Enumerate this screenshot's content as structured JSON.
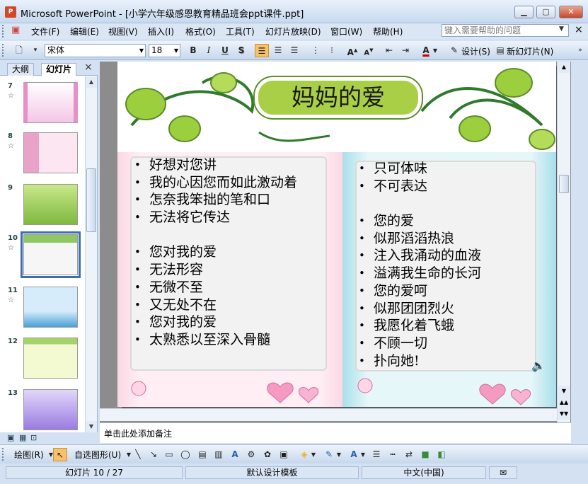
{
  "window": {
    "title": "Microsoft PowerPoint - [小学六年级感恩教育精品班会ppt课件.ppt]",
    "app_icon": "powerpoint-icon",
    "controls": [
      "minimize",
      "maximize",
      "close"
    ]
  },
  "menu": {
    "items": [
      "文件(F)",
      "编辑(E)",
      "视图(V)",
      "插入(I)",
      "格式(O)",
      "工具(T)",
      "幻灯片放映(D)",
      "窗口(W)",
      "帮助(H)"
    ],
    "help_placeholder": "键入需要帮助的问题"
  },
  "toolbar": {
    "font_name": "宋体",
    "font_size": "18",
    "bold": "B",
    "italic": "I",
    "underline": "U",
    "shadow": "S",
    "design_label": "设计(S)",
    "new_slide_label": "新幻灯片(N)"
  },
  "left_panel": {
    "tabs": [
      "大纲",
      "幻灯片"
    ],
    "active_tab": "幻灯片",
    "close_symbol": "×",
    "slides": [
      {
        "number": "7",
        "colors": [
          "#f3c6e6",
          "#ffffff"
        ]
      },
      {
        "number": "8",
        "colors": [
          "#fbe6f2",
          "#e9a3c9"
        ]
      },
      {
        "number": "9",
        "colors": [
          "#c8e88a",
          "#7fb83f"
        ]
      },
      {
        "number": "10",
        "colors": [
          "#d8f0c0",
          "#8dc862"
        ],
        "selected": true
      },
      {
        "number": "11",
        "colors": [
          "#d7ecfb",
          "#4aa0d8"
        ]
      },
      {
        "number": "12",
        "colors": [
          "#f3f9d0",
          "#a5d36a"
        ]
      },
      {
        "number": "13",
        "colors": [
          "#e2d7fa",
          "#9a7be0"
        ]
      }
    ]
  },
  "slide": {
    "title": "妈妈的爱",
    "left_lines": [
      "好想对您讲",
      "我的心因您而如此激动着",
      "怎奈我笨拙的笔和口",
      "无法将它传达",
      "",
      "您对我的爱",
      "无法形容",
      "无微不至",
      "又无处不在",
      "您对我的爱",
      "太熟悉以至深入骨髓"
    ],
    "right_lines": [
      "只可体味",
      "不可表达",
      "",
      "您的爱",
      "似那滔滔热浪",
      "注入我涌动的血液",
      "溢满我生命的长河",
      "您的爱呵",
      "似那团团烈火",
      "我愿化着飞蛾",
      "不顾一切",
      "扑向她!"
    ]
  },
  "notes": {
    "placeholder": "单击此处添加备注"
  },
  "draw_toolbar": {
    "draw_label": "绘图(R)",
    "autoshape_label": "自选图形(U)"
  },
  "status": {
    "slide_position": "幻灯片 10 / 27",
    "template": "默认设计模板",
    "language": "中文(中国)"
  }
}
